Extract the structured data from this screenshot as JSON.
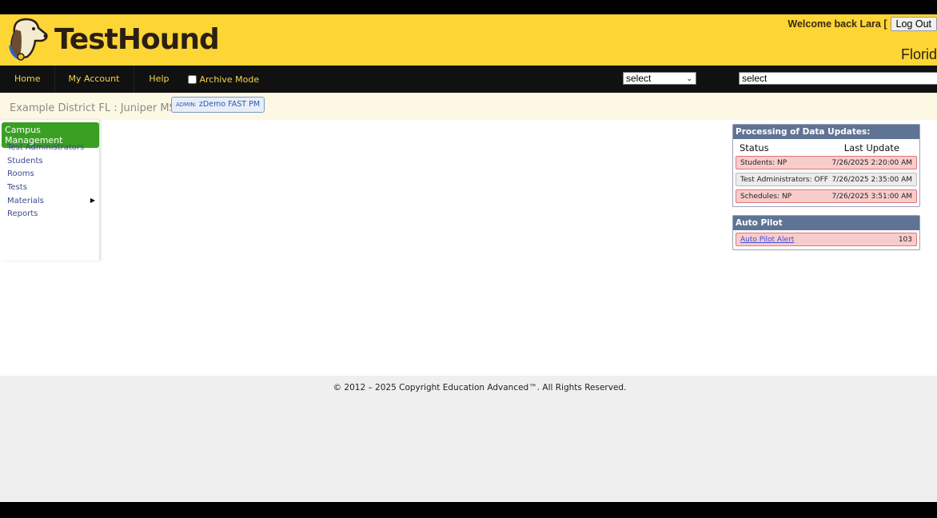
{
  "header": {
    "brand": "TestHound",
    "welcome": "Welcome back Lara [",
    "logout": "Log Out",
    "state": "Florid"
  },
  "nav": {
    "items": [
      "Home",
      "My Account",
      "Help"
    ],
    "archive": "Archive Mode",
    "select1": "select",
    "select2": "select"
  },
  "crumb": {
    "district": "Example District FL : Juniper MS",
    "admin_prefix": "ADMIN:",
    "admin_name": "zDemo FAST PM"
  },
  "sidebar": {
    "title": "Campus Management",
    "links": [
      "Test Administrators",
      "Students",
      "Rooms",
      "Tests",
      "Materials",
      "Reports"
    ]
  },
  "processing": {
    "title": "Processing of Data Updates:",
    "col_status": "Status",
    "col_update": "Last Update",
    "rows": [
      {
        "status": "Students: NP",
        "time": "7/26/2025 2:20:00 AM"
      },
      {
        "status": "Test Administrators: OFF",
        "time": "7/26/2025 2:35:00 AM"
      },
      {
        "status": "Schedules: NP",
        "time": "7/26/2025 3:51:00 AM"
      }
    ]
  },
  "autopilot": {
    "title": "Auto Pilot",
    "alert": "Auto Pilot Alert",
    "count": "103"
  },
  "footer": {
    "copyright": "© 2012 – 2025 Copyright Education Advanced™. All Rights Reserved."
  }
}
